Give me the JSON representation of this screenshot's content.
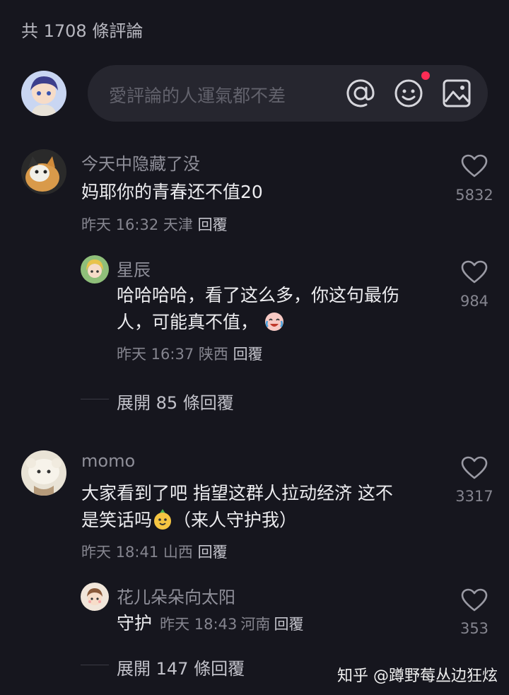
{
  "header": {
    "comment_count": "共 1708 條評論"
  },
  "composer": {
    "placeholder": "愛評論的人運氣都不差",
    "icons": [
      "at-icon",
      "emoji-icon",
      "image-icon"
    ],
    "notification_color": "#fe2c55"
  },
  "comments": [
    {
      "username": "今天中隐藏了没",
      "text": "妈耶你的青春还不值20",
      "time": "昨天 16:32",
      "location": "天津",
      "reply_label": "回覆",
      "likes": "5832",
      "replies": [
        {
          "username": "星辰",
          "text_line1": "哈哈哈哈，看了这么多，你这句最伤",
          "text_line2": "人，可能真不值，",
          "time": "昨天 16:37",
          "location": "陕西",
          "reply_label": "回覆",
          "likes": "984"
        }
      ],
      "expand_label": "展開 85 條回覆"
    },
    {
      "username": "momo",
      "text_line1": "大家看到了吧 指望这群人拉动经济 这不",
      "text_line2": "是笑话吗",
      "text_line2_tail": "（来人守护我）",
      "time": "昨天 18:41",
      "location": "山西",
      "reply_label": "回覆",
      "likes": "3317",
      "replies": [
        {
          "username": "花儿朵朵向太阳",
          "text": "守护",
          "time": "昨天 18:43",
          "location": "河南",
          "reply_label": "回覆",
          "likes": "353"
        }
      ],
      "expand_label": "展開 147 條回覆"
    }
  ],
  "watermark": "知乎 @蹲野莓丛边狂炫"
}
